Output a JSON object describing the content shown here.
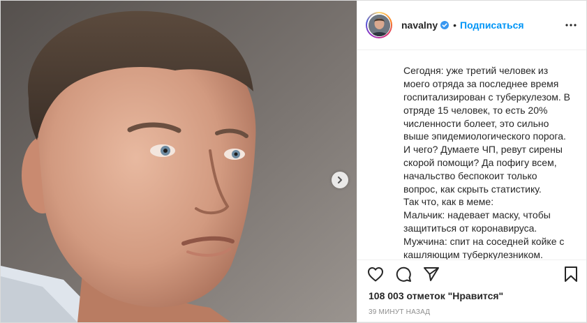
{
  "post": {
    "username": "navalny",
    "dot": "•",
    "follow_label": "Подписаться",
    "verified_icon": "verified-badge-icon",
    "more_icon": "more-options-icon",
    "next_icon": "chevron-right-icon",
    "caption_lines": [
      "Сегодня: уже третий человек из",
      "моего отряда за последнее время",
      "госпитализирован с туберкулезом. В",
      "отряде 15 человек, то есть 20%",
      "численности болеет, это сильно",
      "выше эпидемиологического порога.",
      "И чего? Думаете ЧП, ревут сирены",
      "скорой помощи? Да пофигу всем,",
      "начальство беспокоит только",
      "вопрос, как скрыть статистику.",
      "Так что, как в меме:",
      "Мальчик: надевает маску, чтобы",
      "защититься от коронавируса.",
      "Мужчина: спит на соседней койке с",
      "кашляющим туберкулезником."
    ],
    "likes_text": "108 003 отметок \"Нравится\"",
    "time_text": "39 минут назад",
    "colors": {
      "accent": "#0095f6",
      "text": "#262626",
      "muted": "#8e8e8e",
      "border": "#dbdbdb"
    }
  }
}
